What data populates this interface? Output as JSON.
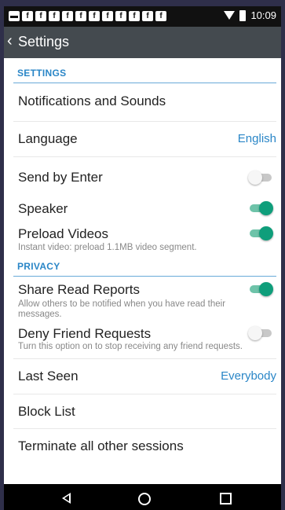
{
  "status_bar": {
    "time": "10:09"
  },
  "header": {
    "back_icon": "chevron-left-icon",
    "title": "Settings"
  },
  "sections": {
    "settings": "SETTINGS",
    "privacy": "PRIVACY"
  },
  "rows": {
    "notifications": {
      "label": "Notifications and Sounds"
    },
    "language": {
      "label": "Language",
      "value": "English"
    },
    "send_by_enter": {
      "label": "Send by Enter",
      "enabled": false
    },
    "speaker": {
      "label": "Speaker",
      "enabled": true
    },
    "preload_videos": {
      "label": "Preload Videos",
      "subtitle": "Instant video: preload 1.1MB video segment.",
      "enabled": true
    },
    "share_read_reports": {
      "label": "Share Read Reports",
      "subtitle": "Allow others to be notified when you have read their messages.",
      "enabled": true
    },
    "deny_friend_requests": {
      "label": "Deny Friend Requests",
      "subtitle": "Turn this option on to stop receiving any friend requests.",
      "enabled": false
    },
    "last_seen": {
      "label": "Last Seen",
      "value": "Everybody"
    },
    "block_list": {
      "label": "Block List"
    },
    "terminate_sessions": {
      "label": "Terminate all other sessions"
    }
  },
  "colors": {
    "accent": "#2a86c7",
    "toggle_on": "#0f9e7b",
    "titlebar": "#444a4f"
  }
}
